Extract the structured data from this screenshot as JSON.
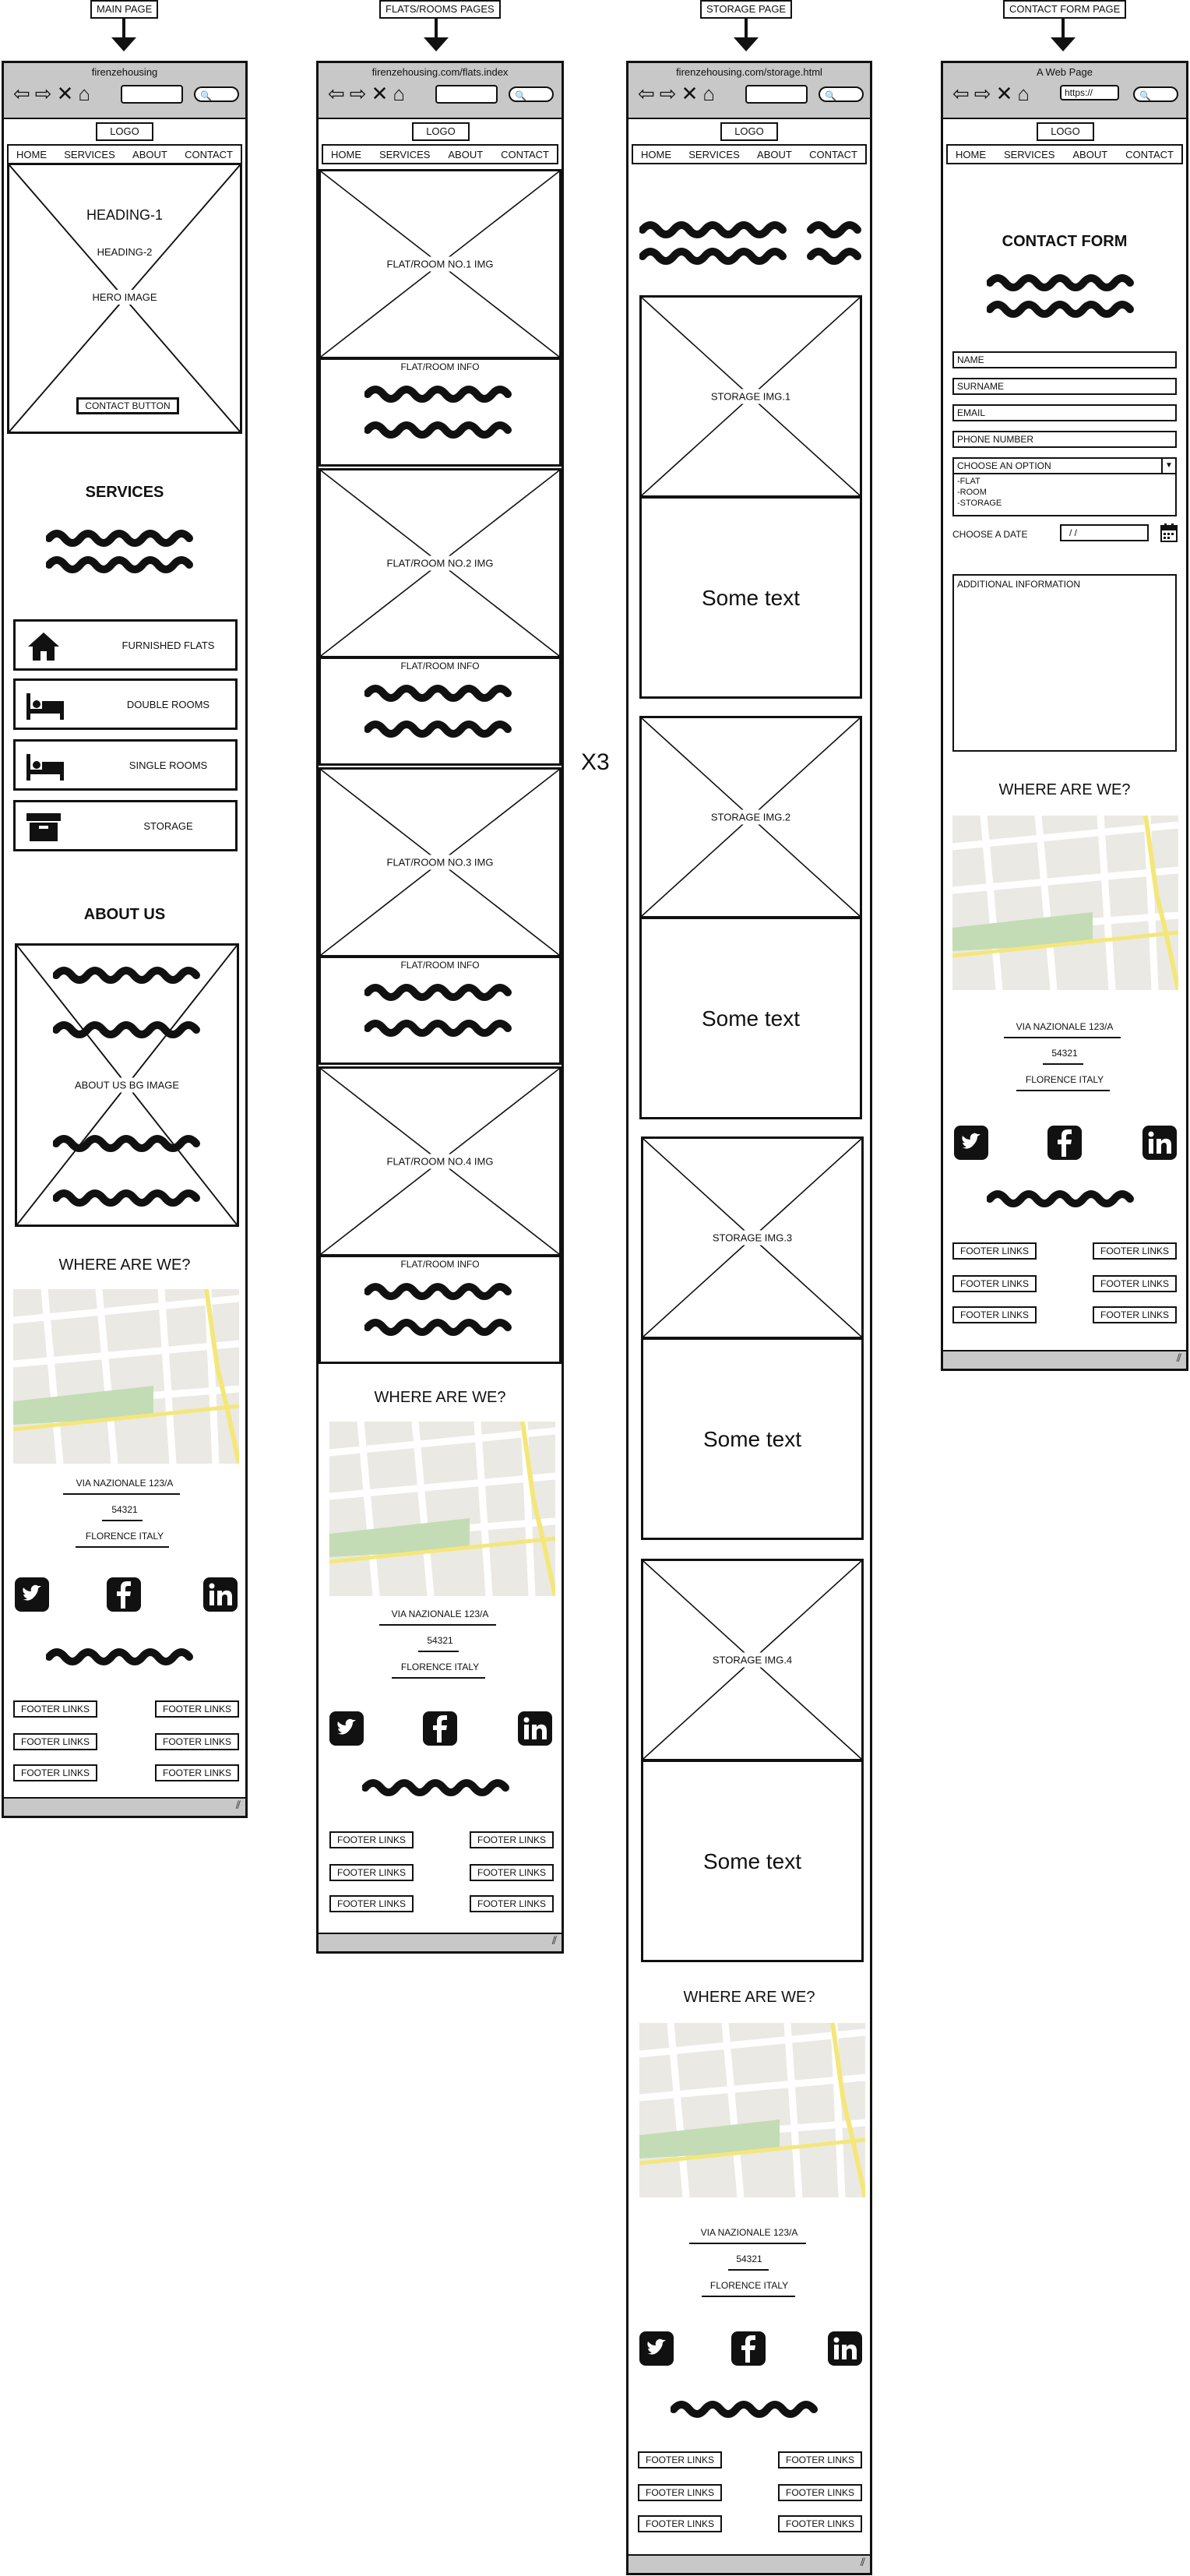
{
  "page_labels": [
    "MAIN PAGE",
    "FLATS/ROOMS PAGES",
    "STORAGE PAGE",
    "CONTACT FORM PAGE"
  ],
  "multiplier": "X3",
  "common": {
    "logo": "LOGO",
    "nav": [
      "HOME",
      "SERVICES",
      "ABOUT",
      "CONTACT"
    ],
    "where_heading": "WHERE ARE WE?",
    "address": [
      "VIA NAZIONALE 123/A",
      "54321",
      "FLORENCE ITALY"
    ],
    "footer_link": "FOOTER LINKS",
    "social_icons": [
      "twitter-icon",
      "facebook-icon",
      "linkedin-icon"
    ]
  },
  "main_page": {
    "url": "firenzehousing",
    "hero": {
      "heading1": "HEADING-1",
      "heading2": "HEADING-2",
      "image": "HERO IMAGE",
      "button": "CONTACT BUTTON"
    },
    "services_heading": "SERVICES",
    "services": [
      {
        "label": "FURNISHED FLATS",
        "icon": "house-icon"
      },
      {
        "label": "DOUBLE ROOMS",
        "icon": "bed-icon"
      },
      {
        "label": "SINGLE ROOMS",
        "icon": "bed-icon"
      },
      {
        "label": "STORAGE",
        "icon": "box-icon"
      }
    ],
    "about_heading": "ABOUT US",
    "about_image": "ABOUT US BG IMAGE"
  },
  "flats_page": {
    "url": "firenzehousing.com/flats.index",
    "items": [
      {
        "image": "FLAT/ROOM NO.1 IMG",
        "info": "FLAT/ROOM INFO"
      },
      {
        "image": "FLAT/ROOM NO.2 IMG",
        "info": "FLAT/ROOM INFO"
      },
      {
        "image": "FLAT/ROOM NO.3 IMG",
        "info": "FLAT/ROOM INFO"
      },
      {
        "image": "FLAT/ROOM NO.4 IMG",
        "info": "FLAT/ROOM INFO"
      }
    ]
  },
  "storage_page": {
    "url": "firenzehousing.com/storage.html",
    "items": [
      {
        "image": "STORAGE IMG.1",
        "text": "Some text"
      },
      {
        "image": "STORAGE IMG.2",
        "text": "Some text"
      },
      {
        "image": "STORAGE IMG.3",
        "text": "Some text"
      },
      {
        "image": "STORAGE IMG.4",
        "text": "Some text"
      }
    ]
  },
  "contact_page": {
    "url": "A Web Page",
    "urlbar_text": "https://",
    "heading": "CONTACT FORM",
    "fields": [
      "NAME",
      "SURNAME",
      "EMAIL",
      "PHONE NUMBER"
    ],
    "select_placeholder": "CHOOSE AN OPTION",
    "options": [
      "-FLAT",
      "-ROOM",
      "-STORAGE"
    ],
    "date_label": "CHOOSE A DATE",
    "date_value": "/  /",
    "additional": "ADDITIONAL INFORMATION"
  }
}
